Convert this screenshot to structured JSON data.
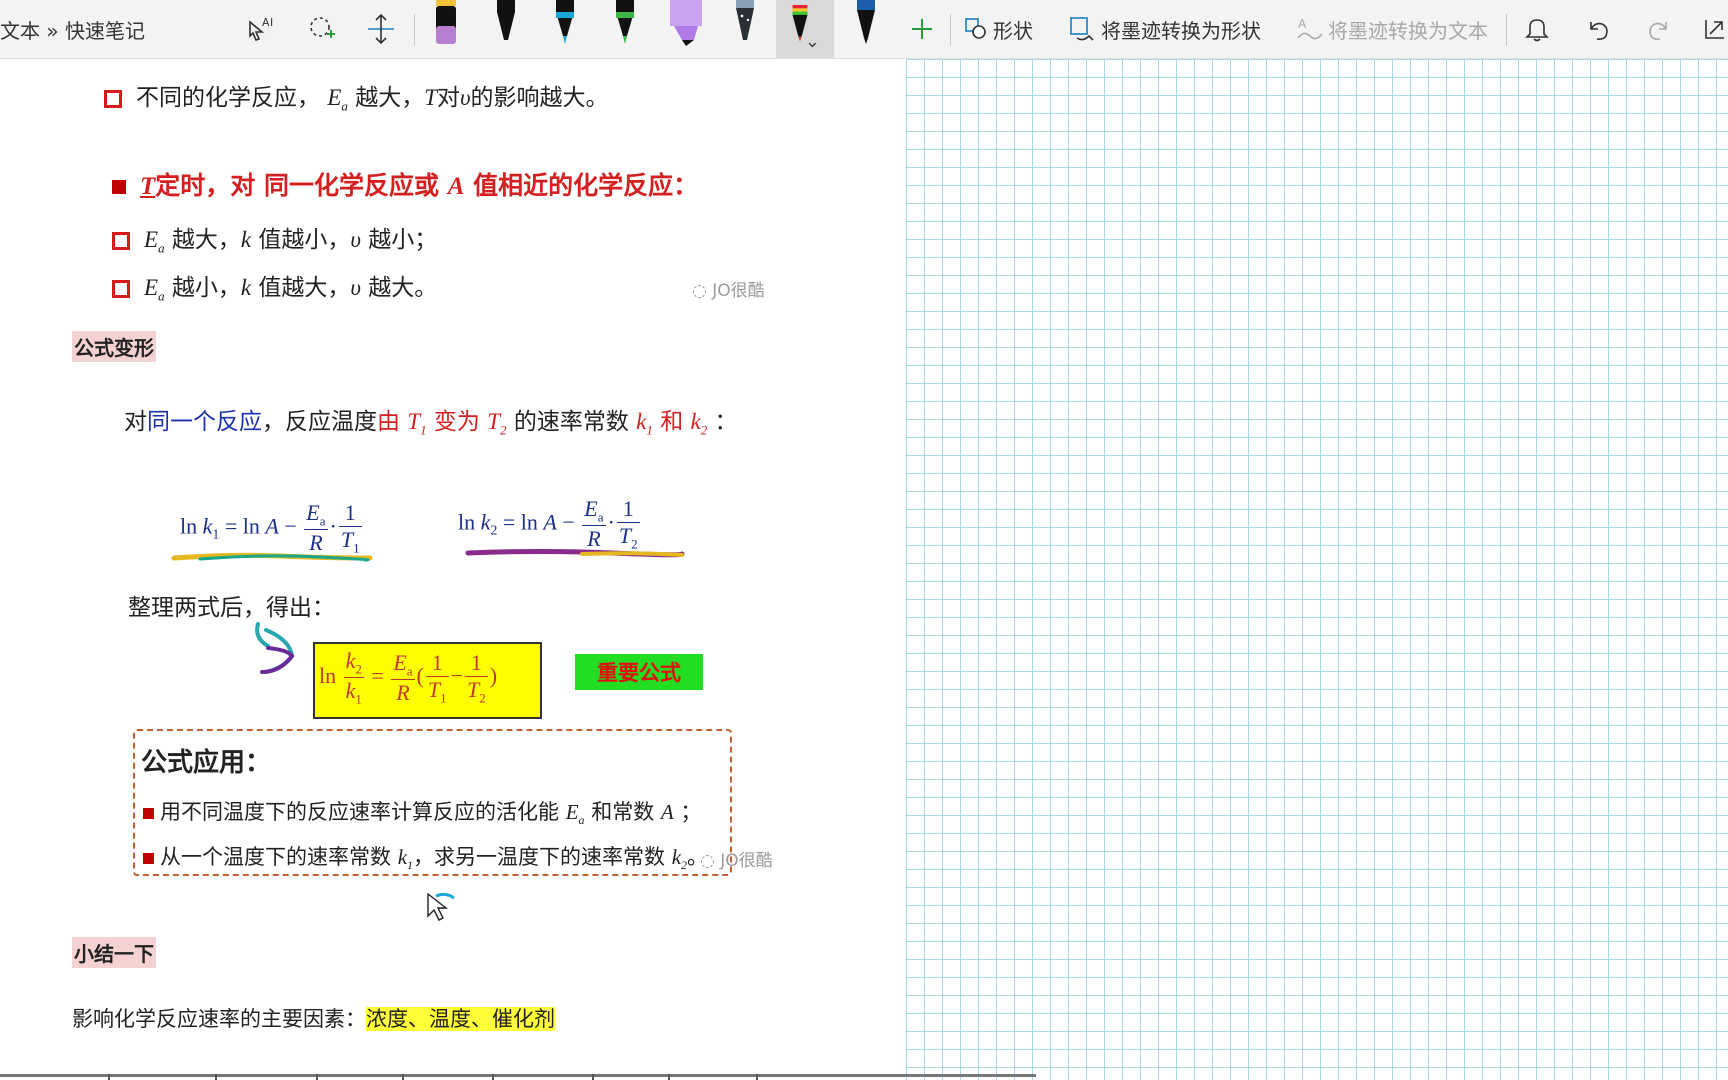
{
  "toolbar": {
    "breadcrumb": "文本 » 快速笔记",
    "shapes_label": "形状",
    "ink_to_shape_label": "将墨迹转换为形状",
    "ink_to_text_label": "将墨迹转换为文本",
    "pens": [
      {
        "name": "purple-highlighter",
        "color": "#b87fd0"
      },
      {
        "name": "black-pen",
        "color": "#1a1a1a"
      },
      {
        "name": "cyan-pen",
        "color": "#1aa7d8"
      },
      {
        "name": "green-pen",
        "color": "#3cb64a"
      },
      {
        "name": "violet-highlighter",
        "color": "#b07be8"
      },
      {
        "name": "galaxy-pen",
        "color": "#4a5a6a"
      },
      {
        "name": "rainbow-pen",
        "color": "#c0392b"
      },
      {
        "name": "ocean-pen",
        "color": "#1c5fa8"
      }
    ]
  },
  "content": {
    "line1_text_a": "不同的化学反应，",
    "line1_text_b": "越大，",
    "line1_text_c": "对",
    "line1_text_d": "的影响越大。",
    "heading_text_a": "定时，对 同一化学反应或",
    "heading_text_b": "值相近的化学反应：",
    "bullet2_text_a": "越大，",
    "bullet2_text_b": "值越小，",
    "bullet2_text_c": "越小；",
    "bullet3_text_a": "越小，",
    "bullet3_text_b": "值越大，",
    "bullet3_text_c": "越大。",
    "watermark": "JO很酷",
    "section_formula_transform": "公式变形",
    "intro_a": "对",
    "intro_b": "同一个反应",
    "intro_c": "，反应温度",
    "intro_d": "由",
    "intro_e": "变为",
    "intro_f": "的速率常数",
    "intro_g": "和",
    "intro_h": "：",
    "organize_text": "整理两式后，得出：",
    "important_label": "重要公式",
    "application_title": "公式应用：",
    "application_1a": "用不同温度下的反应速率计算反应的活化能",
    "application_1b": "和常数",
    "application_1c": "；",
    "application_2a": "从一个温度下的速率常数",
    "application_2b": "，求另一温度下的速率常数",
    "application_2c": "。",
    "section_summary": "小结一下",
    "summary_text": "影响化学反应速率的主要因素：",
    "summary_highlight": "浓度、温度、催化剂"
  }
}
